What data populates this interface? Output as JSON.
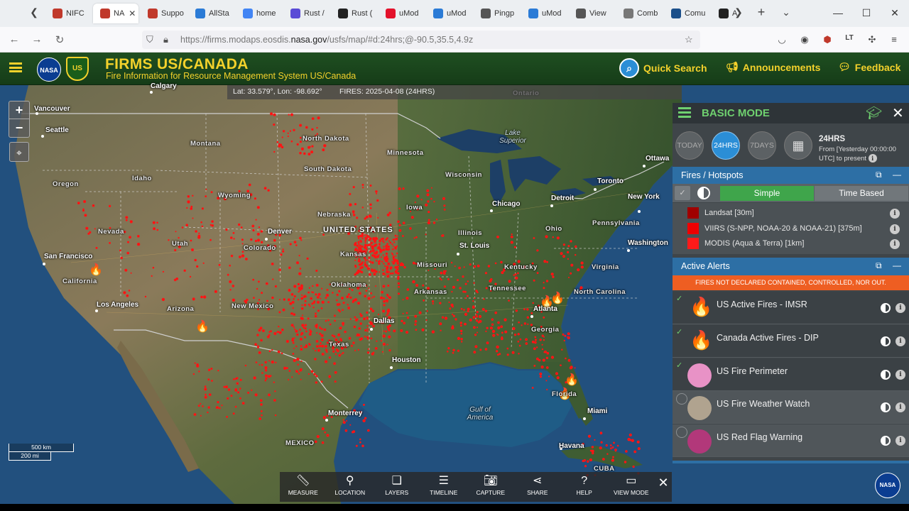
{
  "browser": {
    "tabs": [
      {
        "label": "NIFC",
        "color": "#c0392b"
      },
      {
        "label": "NA",
        "color": "#c0392b",
        "active": true
      },
      {
        "label": "Suppo",
        "color": "#c0392b"
      },
      {
        "label": "AllSta",
        "color": "#2b7bd6"
      },
      {
        "label": "home",
        "color": "#4285f4"
      },
      {
        "label": "Rust /",
        "color": "#5a4bd6"
      },
      {
        "label": "Rust (",
        "color": "#222222"
      },
      {
        "label": "uMod",
        "color": "#e3122b"
      },
      {
        "label": "uMod",
        "color": "#2b7bd6"
      },
      {
        "label": "Pingp",
        "color": "#555555"
      },
      {
        "label": "uMod",
        "color": "#2b7bd6"
      },
      {
        "label": "View",
        "color": "#555555"
      },
      {
        "label": "Comb",
        "color": "#777777"
      },
      {
        "label": "Comu",
        "color": "#1b4f8a"
      },
      {
        "label": "A",
        "color": "#222222"
      }
    ],
    "url_prefix": "https://firms.modaps.eosdis.",
    "url_domain": "nasa.gov",
    "url_suffix": "/usfs/map/#d:24hrs;@-90.5,35.5,4.9z"
  },
  "header": {
    "nasa": "NASA",
    "usfs": "US",
    "title": "FIRMS US/CANADA",
    "subtitle": "Fire Information for Resource Management System US/Canada",
    "quick_search": "Quick Search",
    "announcements": "Announcements",
    "feedback": "Feedback"
  },
  "coordbar": {
    "latlon": "Lat: 33.579°, Lon: -98.692°",
    "fires": "FIRES: 2025-04-08 (24HRS)"
  },
  "map_labels": {
    "cities": [
      "Calgary",
      "Vancouver",
      "Seattle",
      "San Francisco",
      "Los Angeles",
      "Denver",
      "Dallas",
      "Houston",
      "Chicago",
      "St. Louis",
      "Atlanta",
      "Detroit",
      "Toronto",
      "Ottawa",
      "New York",
      "Washington",
      "Miami",
      "Havana",
      "Monterrey"
    ],
    "regions": [
      "Montana",
      "North Dakota",
      "South Dakota",
      "Minnesota",
      "Wisconsin",
      "Idaho",
      "Oregon",
      "Wyoming",
      "Nebraska",
      "Iowa",
      "Nevada",
      "Utah",
      "Colorado",
      "Kansas",
      "Missouri",
      "Illinois",
      "Ohio",
      "Pennsylvania",
      "California",
      "Arizona",
      "New Mexico",
      "Oklahoma",
      "Arkansas",
      "Kentucky",
      "Tennessee",
      "Virginia",
      "North Carolina",
      "Georgia",
      "Texas",
      "Florida",
      "Ontario",
      "MEXICO",
      "CUBA"
    ],
    "country": "UNITED STATES",
    "water": [
      "Lake Superior",
      "Gulf of America"
    ]
  },
  "scale": {
    "km": "500 km",
    "mi": "200 mi"
  },
  "toolbar": {
    "items": [
      {
        "label": "MEASURE",
        "icon": "ruler-icon"
      },
      {
        "label": "LOCATION",
        "icon": "pin-icon"
      },
      {
        "label": "LAYERS",
        "icon": "layers-icon"
      },
      {
        "label": "TIMELINE",
        "icon": "sliders-icon"
      },
      {
        "label": "CAPTURE",
        "icon": "camera-icon"
      },
      {
        "label": "SHARE",
        "icon": "share-icon"
      },
      {
        "label": "HELP",
        "icon": "help-icon"
      },
      {
        "label": "VIEW MODE",
        "icon": "monitor-icon"
      }
    ]
  },
  "panel": {
    "title": "BASIC MODE",
    "range": {
      "today": "TODAY",
      "h24": "24HRS",
      "d7": "7DAYS",
      "title": "24HRS",
      "from": "From [Yesterday 00:00:00 UTC] to present"
    },
    "fires_header": "Fires / Hotspots",
    "simple": "Simple",
    "time_based": "Time Based",
    "hotspots": [
      {
        "label": "Landsat [30m]",
        "color": "#a00000"
      },
      {
        "label": "VIIRS (S-NPP, NOAA-20 & NOAA-21) [375m]",
        "color": "#ee0000"
      },
      {
        "label": "MODIS (Aqua & Terra) [1km]",
        "color": "#ff1a1a"
      }
    ],
    "alerts_header": "Active Alerts",
    "alerts_banner": "FIRES NOT DECLARED CONTAINED, CONTROLLED, NOR OUT.",
    "alerts": [
      {
        "label": "US Active Fires - IMSR",
        "icon": "fire-icon",
        "checked": true
      },
      {
        "label": "Canada Active Fires - DIP",
        "icon": "fire-icon",
        "checked": true
      },
      {
        "label": "US Fire Perimeter",
        "color": "#e892c6",
        "checked": true
      },
      {
        "label": "US Fire Weather Watch",
        "color": "#b0a38f",
        "checked": false
      },
      {
        "label": "US Red Flag Warning",
        "color": "#b2387a",
        "checked": false
      }
    ]
  }
}
